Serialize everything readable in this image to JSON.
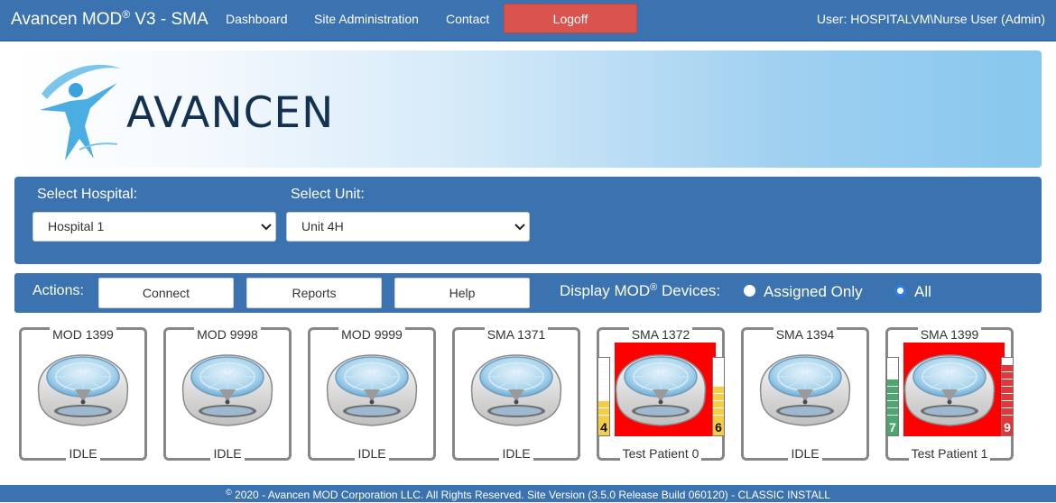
{
  "nav": {
    "brand": "Avancen MOD",
    "brand_reg": "®",
    "brand_suffix": " V3 - SMA",
    "links": [
      "Dashboard",
      "Site Administration",
      "Contact"
    ],
    "logoff": "Logoff",
    "user": "User: HOSPITALVM\\Nurse User (Admin)"
  },
  "banner": {
    "logo_text": "AVANCEN"
  },
  "filters": {
    "hospital_label": "Select Hospital:",
    "hospital_value": "Hospital 1",
    "unit_label": "Select Unit:",
    "unit_value": "Unit 4H"
  },
  "actions": {
    "label": "Actions:",
    "buttons": [
      "Connect",
      "Reports",
      "Help"
    ],
    "display_label": "Display MOD",
    "display_reg": "®",
    "display_suffix": " Devices:",
    "radio_assigned": "Assigned Only",
    "radio_all": "All",
    "radio_selected": "All"
  },
  "devices": [
    {
      "name": "MOD 1399",
      "status": "IDLE",
      "alarm": false
    },
    {
      "name": "MOD 9998",
      "status": "IDLE",
      "alarm": false
    },
    {
      "name": "MOD 9999",
      "status": "IDLE",
      "alarm": false
    },
    {
      "name": "SMA 1371",
      "status": "IDLE",
      "alarm": false
    },
    {
      "name": "SMA 1372",
      "status": "Test Patient 0",
      "alarm": true,
      "left_meter": {
        "value": "4",
        "color": "#f6cd45"
      },
      "right_meter": {
        "value": "6",
        "color": "#f6cd45"
      }
    },
    {
      "name": "SMA 1394",
      "status": "IDLE",
      "alarm": false
    },
    {
      "name": "SMA 1399",
      "status": "Test Patient 1",
      "alarm": true,
      "left_meter": {
        "value": "7",
        "color": "#4aa86e"
      },
      "right_meter": {
        "value": "9",
        "color": "#e0373a"
      }
    }
  ],
  "footer": {
    "copy": "©",
    "text": " 2020 - Avancen MOD Corporation LLC. All Rights Reserved. Site Version (3.5.0 Release Build 060120) - CLASSIC INSTALL"
  },
  "colors": {
    "nav_bg": "#3b73b1",
    "logoff": "#d9534f",
    "alarm": "#ff0000"
  }
}
